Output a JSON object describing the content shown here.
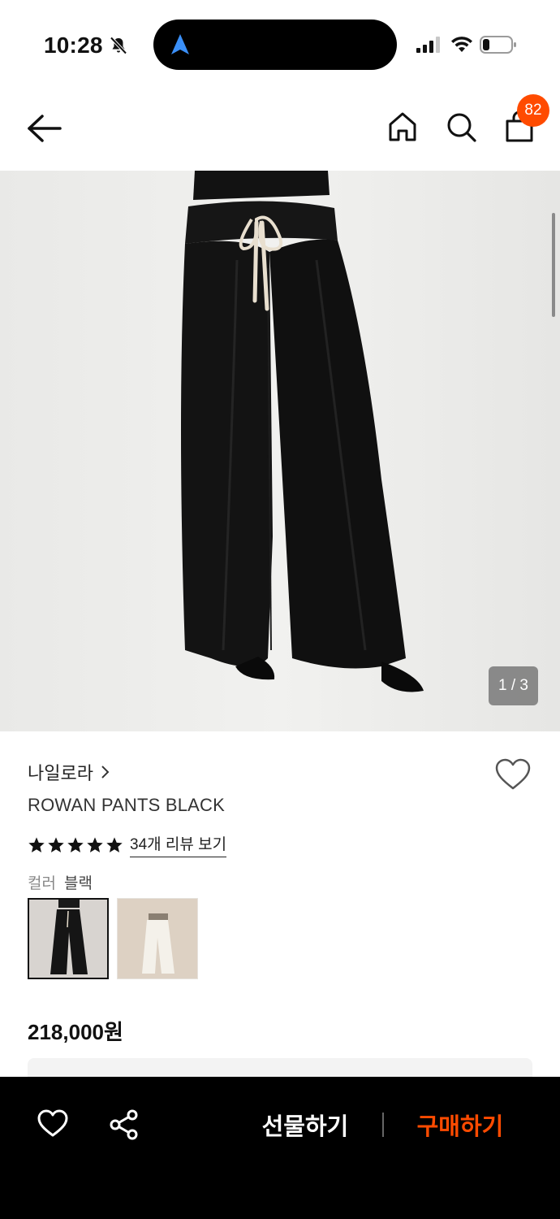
{
  "status_bar": {
    "time": "10:28"
  },
  "header": {
    "cart_count": "82"
  },
  "gallery": {
    "counter": "1 / 3",
    "current_image": 1,
    "total_images": 3
  },
  "product": {
    "brand": "나일로라",
    "name": "ROWAN PANTS BLACK",
    "rating_stars": 5,
    "review_link": "34개 리뷰 보기",
    "color_label": "컬러",
    "color_value": "블랙",
    "price": "218,000원"
  },
  "colors": {
    "accent": "#ff4b00",
    "bottom_bar": "#000000"
  },
  "icons": [
    "bell-slash-icon",
    "navigation-arrow-icon",
    "signal-icon",
    "wifi-icon",
    "battery-icon",
    "back-arrow-icon",
    "home-icon",
    "search-icon",
    "shopping-bag-icon",
    "heart-icon",
    "share-icon",
    "chevron-right-icon",
    "star-icon"
  ],
  "bottom_bar": {
    "gift_label": "선물하기",
    "buy_label": "구매하기"
  }
}
